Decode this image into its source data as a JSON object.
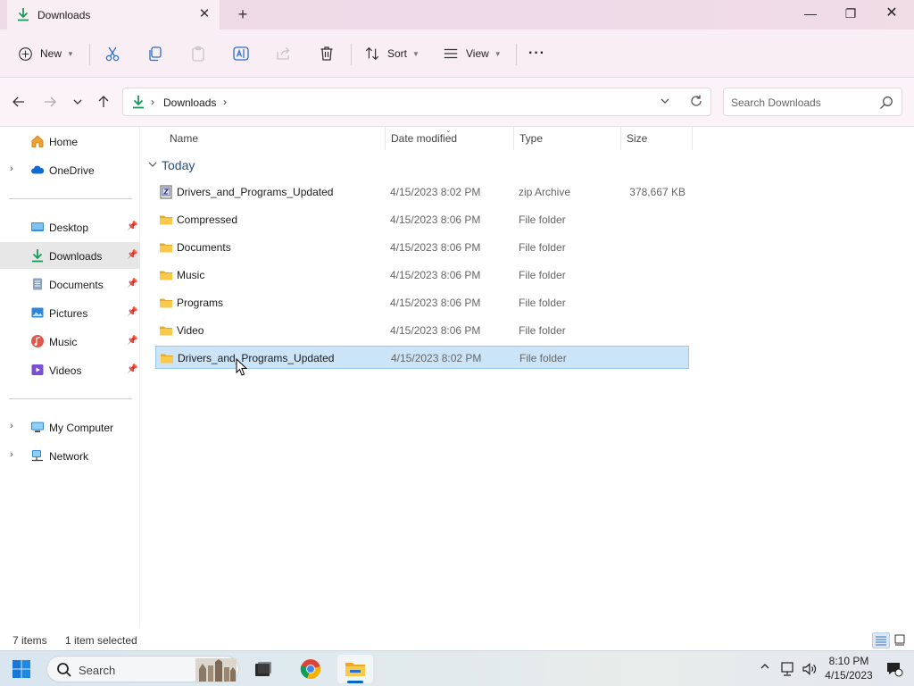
{
  "window": {
    "tab_title": "Downloads",
    "tab_close": "✕",
    "new_tab": "+",
    "minimize": "—",
    "maximize": "❐",
    "close": "✕"
  },
  "toolbar": {
    "new_label": "New",
    "sort_label": "Sort",
    "view_label": "View",
    "more": "···",
    "icons": [
      "add-icon",
      "cut-icon",
      "copy-icon",
      "paste-icon",
      "rename-icon",
      "share-icon",
      "delete-icon",
      "sort-icon",
      "view-icon"
    ]
  },
  "address": {
    "crumb": "Downloads",
    "search_placeholder": "Search Downloads"
  },
  "sidebar": {
    "items": [
      {
        "label": "Home",
        "icon": "home-icon"
      },
      {
        "label": "OneDrive",
        "icon": "cloud-icon"
      },
      {
        "label": "Desktop",
        "icon": "desktop-icon"
      },
      {
        "label": "Downloads",
        "icon": "download-icon"
      },
      {
        "label": "Documents",
        "icon": "document-icon"
      },
      {
        "label": "Pictures",
        "icon": "pictures-icon"
      },
      {
        "label": "Music",
        "icon": "music-icon"
      },
      {
        "label": "Videos",
        "icon": "videos-icon"
      },
      {
        "label": "My Computer",
        "icon": "computer-icon"
      },
      {
        "label": "Network",
        "icon": "network-icon"
      }
    ]
  },
  "columns": {
    "name": "Name",
    "date": "Date modified",
    "type": "Type",
    "size": "Size"
  },
  "group": {
    "label": "Today"
  },
  "files": [
    {
      "name": "Drivers_and_Programs_Updated",
      "date": "4/15/2023 8:02 PM",
      "type": "zip Archive",
      "size": "378,667 KB",
      "icon": "zip-icon"
    },
    {
      "name": "Compressed",
      "date": "4/15/2023 8:06 PM",
      "type": "File folder",
      "size": "",
      "icon": "folder-icon"
    },
    {
      "name": "Documents",
      "date": "4/15/2023 8:06 PM",
      "type": "File folder",
      "size": "",
      "icon": "folder-icon"
    },
    {
      "name": "Music",
      "date": "4/15/2023 8:06 PM",
      "type": "File folder",
      "size": "",
      "icon": "folder-icon"
    },
    {
      "name": "Programs",
      "date": "4/15/2023 8:06 PM",
      "type": "File folder",
      "size": "",
      "icon": "folder-icon"
    },
    {
      "name": "Video",
      "date": "4/15/2023 8:06 PM",
      "type": "File folder",
      "size": "",
      "icon": "folder-icon"
    },
    {
      "name": "Drivers_and_Programs_Updated",
      "date": "4/15/2023 8:02 PM",
      "type": "File folder",
      "size": "",
      "icon": "folder-icon"
    }
  ],
  "status": {
    "count": "7 items",
    "selection": "1 item selected"
  },
  "taskbar": {
    "search_label": "Search",
    "time": "8:10 PM",
    "date": "4/15/2023"
  },
  "colors": {
    "accent": "#0067c0",
    "selection": "#cce4f7",
    "folder": "#f4c542",
    "download_green": "#1a9a5a"
  }
}
